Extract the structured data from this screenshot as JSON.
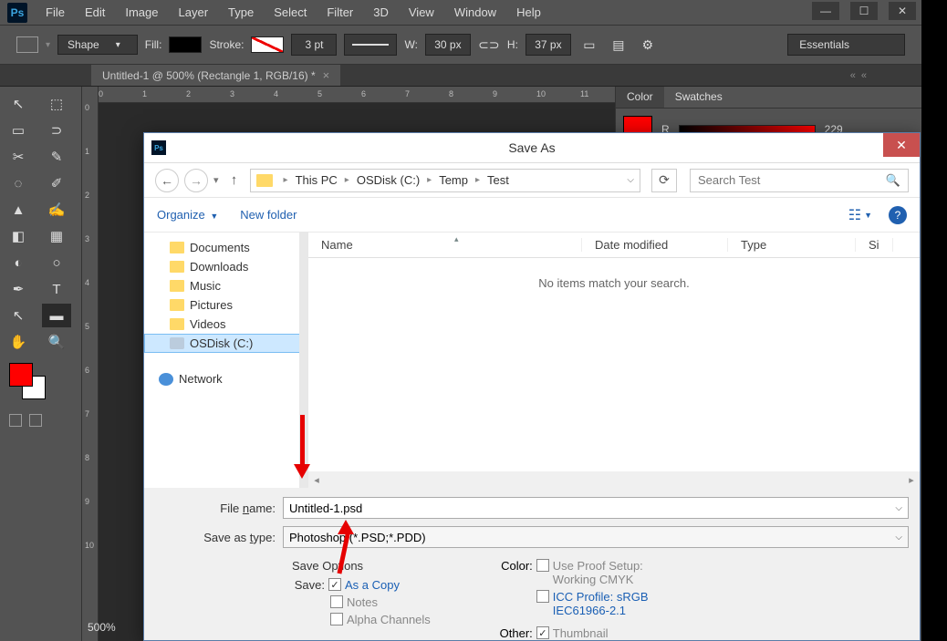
{
  "menubar": [
    "File",
    "Edit",
    "Image",
    "Layer",
    "Type",
    "Select",
    "Filter",
    "3D",
    "View",
    "Window",
    "Help"
  ],
  "optbar": {
    "shape": "Shape",
    "fill": "Fill:",
    "stroke": "Stroke:",
    "strokeW": "3 pt",
    "wlab": "W:",
    "wval": "30 px",
    "hlab": "H:",
    "hval": "37 px",
    "workspace": "Essentials"
  },
  "doc_tab": "Untitled-1 @ 500% (Rectangle 1, RGB/16) *",
  "ruler_h": [
    "0",
    "1",
    "2",
    "3",
    "4",
    "5",
    "6",
    "7",
    "8",
    "9",
    "10",
    "11"
  ],
  "ruler_v": [
    "0",
    "1",
    "2",
    "3",
    "4",
    "5",
    "6",
    "7",
    "8",
    "9",
    "10"
  ],
  "zoom": "500%",
  "right_panel": {
    "tabs": [
      "Color",
      "Swatches"
    ],
    "r_label": "R",
    "r_val": "229"
  },
  "dialog": {
    "title": "Save As",
    "breadcrumbs": [
      "This PC",
      "OSDisk (C:)",
      "Temp",
      "Test"
    ],
    "search_placeholder": "Search Test",
    "organize": "Organize",
    "newfolder": "New folder",
    "tree": [
      {
        "label": "Documents",
        "icon": "folder"
      },
      {
        "label": "Downloads",
        "icon": "folder"
      },
      {
        "label": "Music",
        "icon": "folder"
      },
      {
        "label": "Pictures",
        "icon": "folder"
      },
      {
        "label": "Videos",
        "icon": "folder"
      },
      {
        "label": "OSDisk (C:)",
        "icon": "disk",
        "sel": true
      }
    ],
    "network": "Network",
    "columns": {
      "name": "Name",
      "date": "Date modified",
      "type": "Type",
      "size": "Si"
    },
    "empty": "No items match your search.",
    "filename_lbl": "File name:",
    "filename": "Untitled-1.psd",
    "savetype_lbl": "Save as type:",
    "savetype": "Photoshop (*.PSD;*.PDD)",
    "save_options": "Save Options",
    "save_lbl": "Save:",
    "as_copy": "As a Copy",
    "notes": "Notes",
    "alpha": "Alpha Channels",
    "color_lbl": "Color:",
    "proof": "Use Proof Setup:",
    "proof2": "Working CMYK",
    "icc": "ICC Profile:  sRGB",
    "icc2": "IEC61966-2.1",
    "other_lbl": "Other:",
    "thumb": "Thumbnail"
  }
}
